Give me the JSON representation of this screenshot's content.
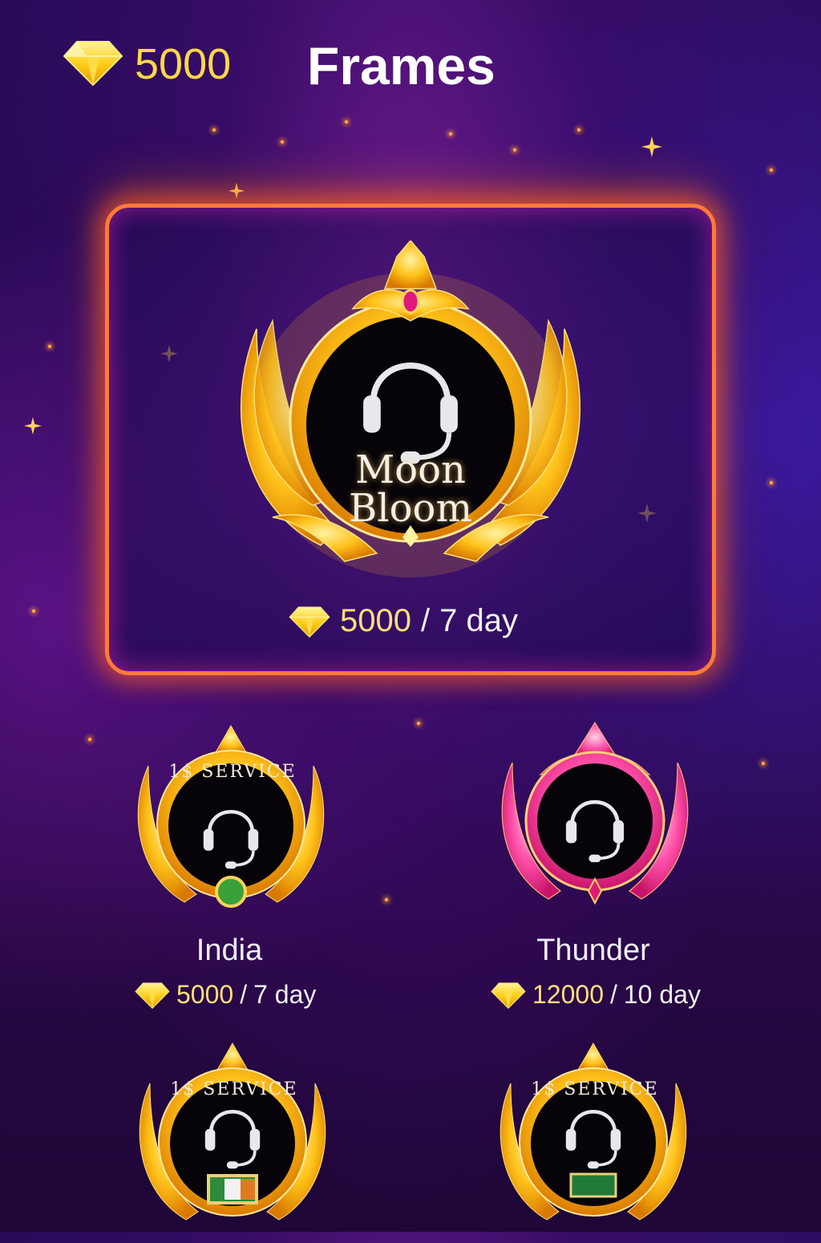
{
  "header": {
    "balance": "5000",
    "balance_icon": "diamond-icon",
    "title": "Frames"
  },
  "featured": {
    "frame_text_line1": "Moon",
    "frame_text_line2": "Bloom",
    "price_value": "5000",
    "price_sep": "/",
    "price_duration": "7 day",
    "icon": "headset-icon"
  },
  "items": [
    {
      "name": "India",
      "price_value": "5000",
      "price_sep": "/",
      "price_duration": "7 day",
      "badge": "1$ SERVICE"
    },
    {
      "name": "Thunder",
      "price_value": "12000",
      "price_sep": "/",
      "price_duration": "10 day"
    },
    {
      "badge": "1$ SERVICE"
    },
    {
      "badge": "1$ SERVICE"
    }
  ],
  "colors": {
    "gold": "#ffd84a",
    "card_border": "#ff7a3a",
    "pink_frame": "#ff4fa8"
  }
}
